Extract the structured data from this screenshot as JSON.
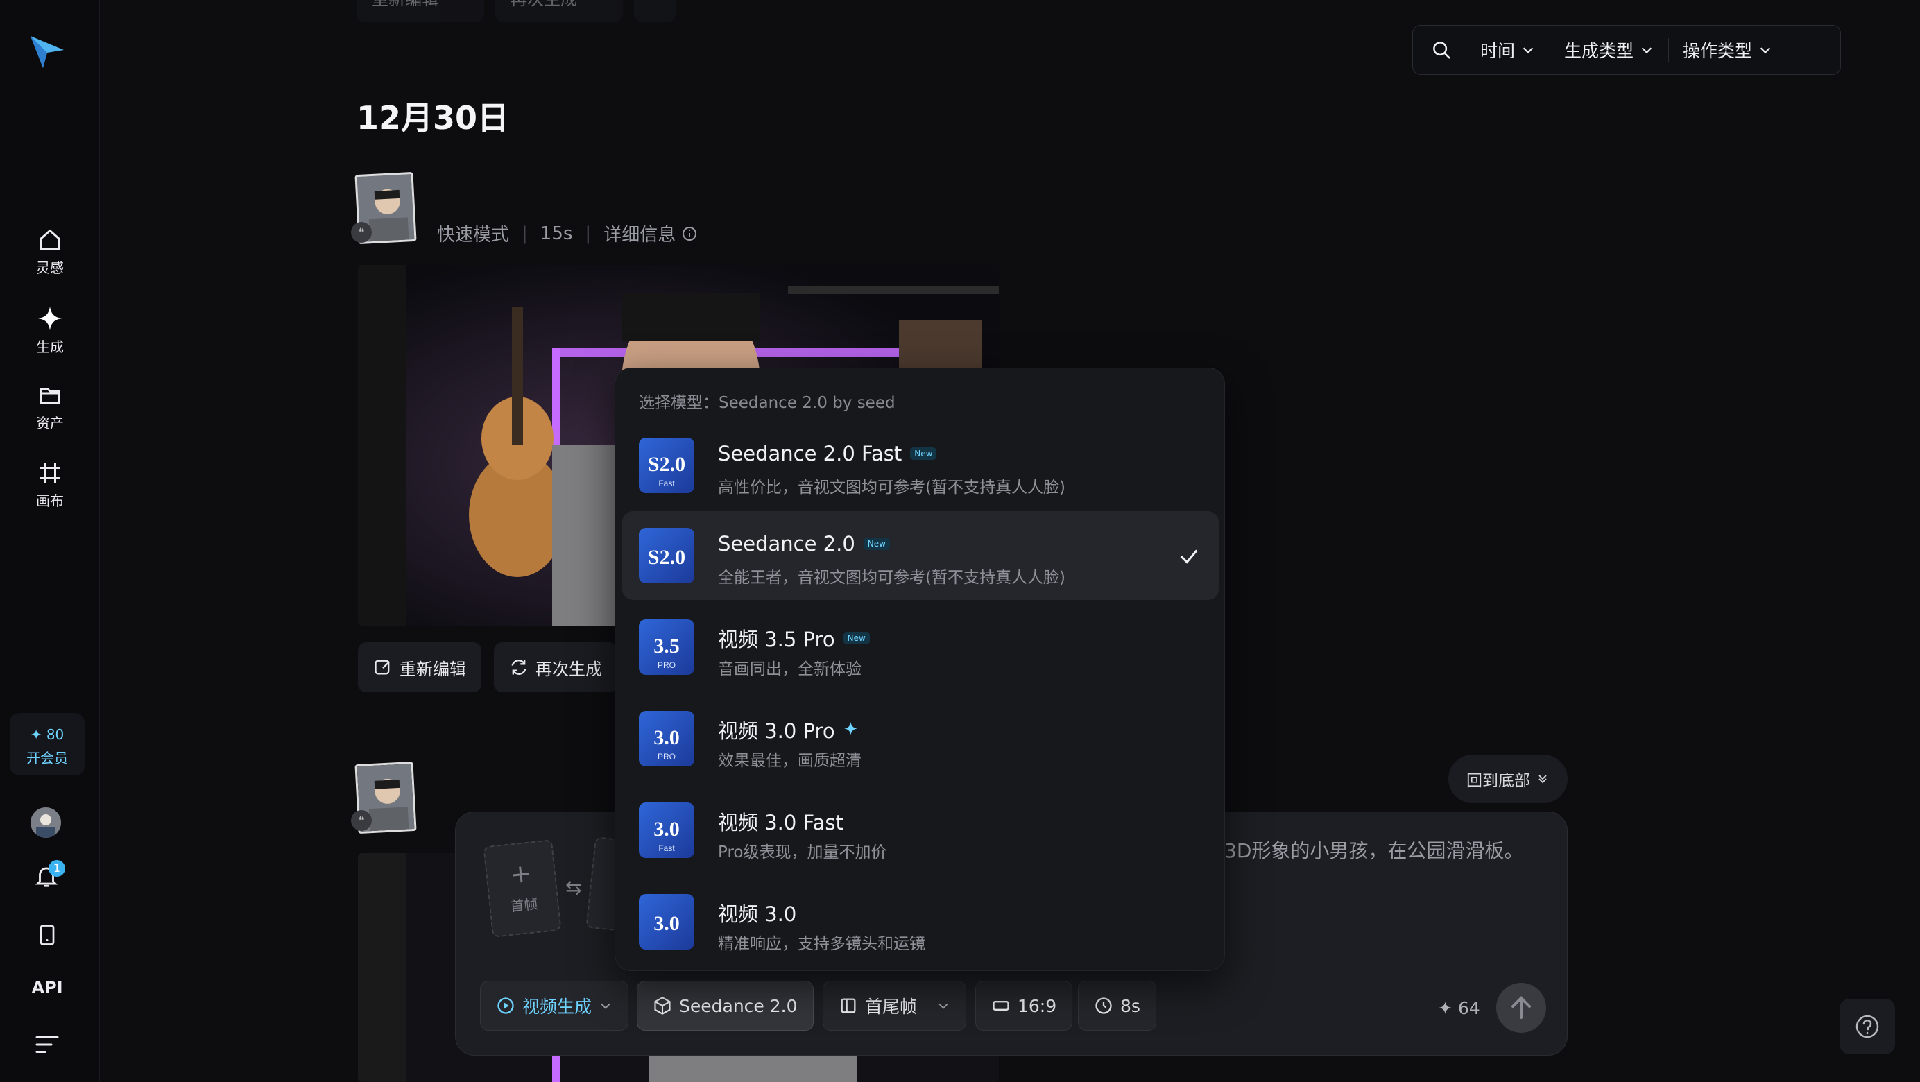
{
  "sidebar": {
    "items": [
      {
        "label": "灵感",
        "icon": "home-icon"
      },
      {
        "label": "生成",
        "icon": "sparkle-icon"
      },
      {
        "label": "资产",
        "icon": "folder-icon"
      },
      {
        "label": "画布",
        "icon": "canvas-icon"
      }
    ],
    "credits": "80",
    "vip_label": "开会员",
    "notification_count": "1",
    "api_label": "API"
  },
  "filters": {
    "time": "时间",
    "gen_type": "生成类型",
    "op_type": "操作类型"
  },
  "date_heading": "12月30日",
  "record1": {
    "mode": "快速模式",
    "duration": "15s",
    "details": "详细信息"
  },
  "actions": {
    "re_edit": "重新编辑",
    "regenerate": "再次生成"
  },
  "back_to_bottom": "回到底部",
  "model_popup": {
    "header": "选择模型：Seedance 2.0 by seed",
    "models": [
      {
        "name": "Seedance 2.0 Fast",
        "badge": "New",
        "desc": "高性价比，音视文图均可参考(暂不支持真人人脸)",
        "logo_main": "S2.0",
        "logo_sub": "Fast",
        "selected": false
      },
      {
        "name": "Seedance 2.0",
        "badge": "New",
        "desc": "全能王者，音视文图均可参考(暂不支持真人人脸)",
        "logo_main": "S2.0",
        "logo_sub": "",
        "selected": true
      },
      {
        "name": "视频 3.5 Pro",
        "badge": "New",
        "desc": "音画同出，全新体验",
        "logo_main": "3.5",
        "logo_sub": "PRO",
        "selected": false
      },
      {
        "name": "视频 3.0 Pro",
        "badge": "",
        "desc": "效果最佳，画质超清",
        "logo_main": "3.0",
        "logo_sub": "PRO",
        "selected": false
      },
      {
        "name": "视频 3.0 Fast",
        "badge": "",
        "desc": "Pro级表现，加量不加价",
        "logo_main": "3.0",
        "logo_sub": "Fast",
        "selected": false
      },
      {
        "name": "视频 3.0",
        "badge": "",
        "desc": "精准响应，支持多镜头和运镜",
        "logo_main": "3.0",
        "logo_sub": "",
        "selected": false
      }
    ]
  },
  "composer": {
    "first_frame": "首帧",
    "prompt_tail": "3D形象的小男孩，在公园滑滑板。",
    "tools": {
      "mode": "视频生成",
      "model": "Seedance 2.0",
      "frames": "首尾帧",
      "ratio": "16:9",
      "duration": "8s"
    },
    "cost": "64"
  },
  "colors": {
    "accent": "#6fd3ff",
    "bg": "#0d0d10",
    "popup": "#17181c"
  }
}
